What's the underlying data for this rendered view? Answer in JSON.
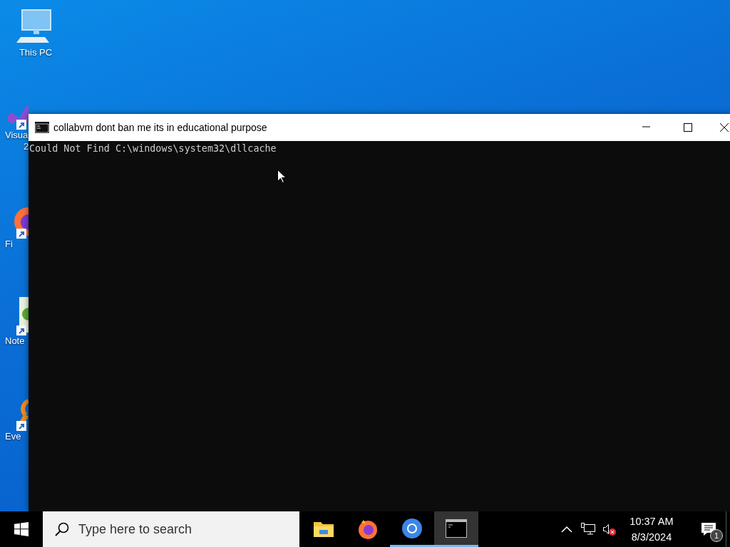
{
  "desktop": {
    "icons": [
      {
        "kind": "computer",
        "label": "This PC"
      },
      {
        "kind": "visual-studio",
        "label": "Visua",
        "label_2": "2"
      },
      {
        "kind": "firefox",
        "label": "Fi"
      },
      {
        "kind": "notepad",
        "label": "Note"
      },
      {
        "kind": "everything",
        "label": "Eve"
      }
    ]
  },
  "window": {
    "title": "collabvm dont ban me its in educational purpose",
    "console_lines": [
      "Could Not Find C:\\windows\\system32\\dllcache"
    ]
  },
  "taskbar": {
    "search": {
      "placeholder": "Type here to search"
    },
    "apps": [
      {
        "kind": "explorer",
        "running": false,
        "active": false
      },
      {
        "kind": "firefox",
        "running": false,
        "active": false
      },
      {
        "kind": "chrome",
        "running": true,
        "active": false
      },
      {
        "kind": "console",
        "running": true,
        "active": true
      }
    ],
    "tray": {
      "volume_muted": true,
      "time": "10:37 AM",
      "date": "8/3/2024",
      "notification_count": "1"
    }
  }
}
